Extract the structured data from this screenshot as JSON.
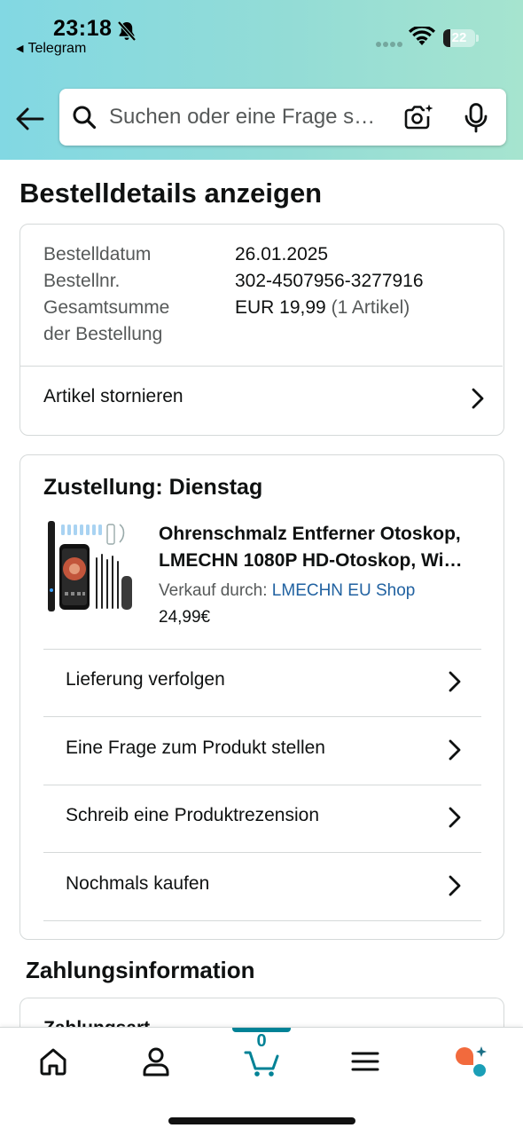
{
  "status_bar": {
    "time": "23:18",
    "back_app": "Telegram",
    "battery_level": "22",
    "battery_fraction": 0.22
  },
  "header": {
    "search_placeholder": "Suchen oder eine Frage s…"
  },
  "page": {
    "title": "Bestelldetails anzeigen"
  },
  "summary": {
    "rows": [
      {
        "label": "Bestelldatum",
        "value": "26.01.2025"
      },
      {
        "label": "Bestellnr.",
        "value": "302-4507956-3277916"
      },
      {
        "label": "Gesamtsumme",
        "value": "EUR 19,99",
        "value_extra": "(1 Artikel)"
      },
      {
        "label": "der Bestellung"
      }
    ],
    "cancel_label": "Artikel stornieren"
  },
  "delivery": {
    "title": "Zustellung: Dienstag",
    "product": {
      "title_line1": "Ohrenschmalz Entferner Otoskop,",
      "title_line2": "LMECHN 1080P HD-Otoskop, Wi…",
      "seller_prefix": "Verkauf durch: ",
      "seller_name": "LMECHN EU Shop",
      "price": "24,99€"
    },
    "actions": [
      {
        "label": "Lieferung verfolgen"
      },
      {
        "label": "Eine Frage zum Produkt stellen"
      },
      {
        "label": "Schreib eine Produktrezension"
      },
      {
        "label": "Nochmals kaufen"
      }
    ]
  },
  "payment": {
    "section_title": "Zahlungsinformation",
    "peek_text": "Zahlungsart"
  },
  "bottom_nav": {
    "cart_count": "0",
    "items": [
      "home-icon",
      "account-icon",
      "cart-icon",
      "menu-icon",
      "rufus-icon"
    ]
  },
  "colors": {
    "header_gradient_start": "#82d8e3",
    "header_gradient_end": "#a6e4cf",
    "link": "#2162a1",
    "active_tab": "#008296",
    "rufus_orange": "#f26a3d",
    "rufus_teal": "#1b9fb7"
  }
}
